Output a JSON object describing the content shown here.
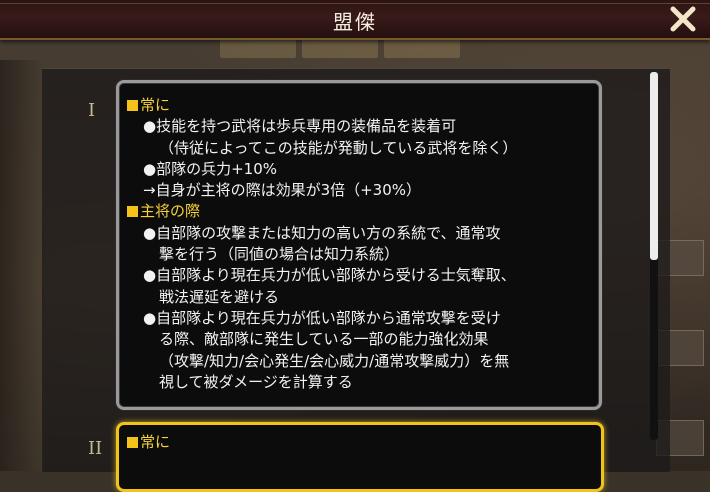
{
  "header": {
    "title": "盟傑"
  },
  "close": {
    "icon": "close-icon"
  },
  "rows": [
    {
      "mark": "I"
    },
    {
      "mark": "II"
    }
  ],
  "card1": {
    "section1_heading": "常に",
    "line1": "●技能を持つ武将は歩兵専用の装備品を装着可",
    "line2": "（侍従によってこの技能が発動している武将を除く）",
    "line3": "●部隊の兵力+10%",
    "line4": "→自身が主将の際は効果が3倍（+30%）",
    "section2_heading": "主将の際",
    "line5": "●自部隊の攻撃または知力の高い方の系統で、通常攻",
    "line6": "撃を行う（同値の場合は知力系統）",
    "line7": "●自部隊より現在兵力が低い部隊から受ける士気奪取、",
    "line8": "戦法遅延を避ける",
    "line9": "●自部隊より現在兵力が低い部隊から通常攻撃を受け",
    "line10": "る際、敵部隊に発生している一部の能力強化効果",
    "line11": "（攻撃/知力/会心発生/会心威力/通常攻撃威力）を無",
    "line12": "視して被ダメージを計算する"
  },
  "card2": {
    "heading": "常に"
  },
  "colors": {
    "accent_yellow": "#f5c21a",
    "header_red": "#3a1a1a",
    "highlight_border": "#f0c41a"
  }
}
